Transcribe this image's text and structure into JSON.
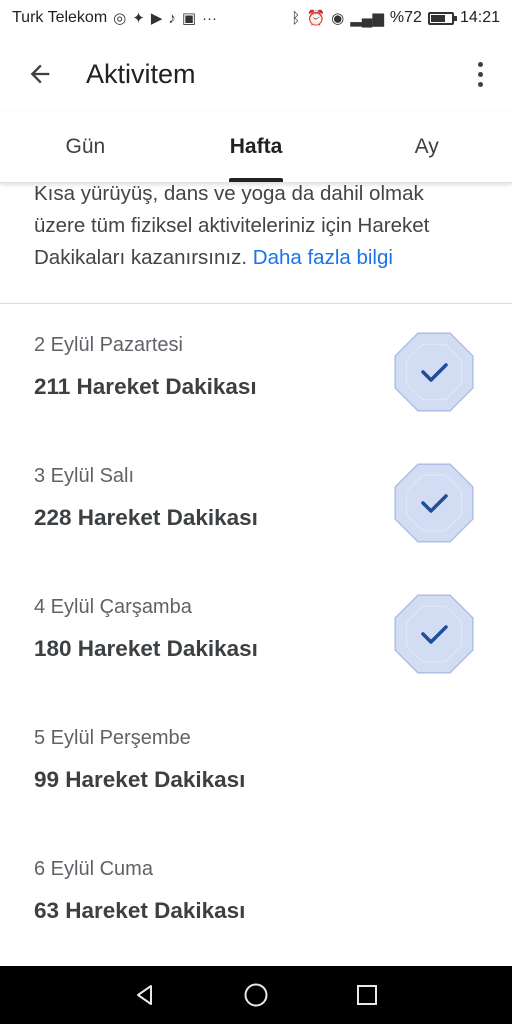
{
  "status_bar": {
    "carrier": "Turk Telekom",
    "battery_text": "%72",
    "battery_level": 0.72,
    "time": "14:21",
    "left_icons": [
      "whatsapp-icon",
      "twitter-icon",
      "youtube-icon",
      "music-icon",
      "app-icon",
      "more-notifications-icon"
    ],
    "right_icons": [
      "bluetooth-icon",
      "alarm-icon",
      "eye-icon",
      "signal-icon"
    ]
  },
  "app_bar": {
    "title": "Aktivitem"
  },
  "tabs": [
    {
      "label": "Gün",
      "active": false
    },
    {
      "label": "Hafta",
      "active": true
    },
    {
      "label": "Ay",
      "active": false
    }
  ],
  "info": {
    "line1": "Kısa yürüyüş, dans ve yoga da dahil olmak",
    "line2": "üzere tüm fiziksel aktiviteleriniz için Hareket",
    "line3": "Dakikaları kazanırsınız.",
    "link": "Daha fazla bilgi"
  },
  "days": [
    {
      "date": "2 Eylül Pazartesi",
      "value": "211 Hareket Dakikası",
      "goal_met": true
    },
    {
      "date": "3 Eylül Salı",
      "value": "228 Hareket Dakikası",
      "goal_met": true
    },
    {
      "date": "4 Eylül Çarşamba",
      "value": "180 Hareket Dakikası",
      "goal_met": true
    },
    {
      "date": "5 Eylül Perşembe",
      "value": "99 Hareket Dakikası",
      "goal_met": false
    },
    {
      "date": "6 Eylül Cuma",
      "value": "63 Hareket Dakikası",
      "goal_met": false
    }
  ],
  "colors": {
    "badge_fill": "#d2dcf2",
    "badge_stroke": "#aebfe6",
    "check": "#1f4e9a",
    "link": "#1a73e8"
  }
}
